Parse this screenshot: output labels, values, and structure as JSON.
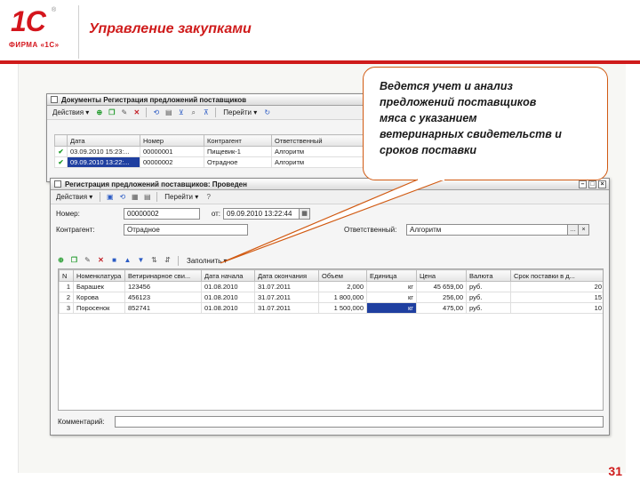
{
  "slide": {
    "logo_1c": "1С",
    "logo_reg": "®",
    "logo_firma": "ФИРМА «1С»",
    "title": "Управление закупками",
    "page_number": "31",
    "accent": "#cf1b1b"
  },
  "list_window": {
    "title": "Документы Регистрация предложений поставщиков",
    "toolbar": {
      "actions_label": "Действия ▾",
      "goto_label": "Перейти ▾"
    },
    "columns": [
      "Дата",
      "Номер",
      "Контрагент",
      "Ответственный"
    ],
    "rows": [
      {
        "date": "03.09.2010 15:23:...",
        "number": "00000001",
        "counterparty": "Пищевик-1",
        "responsible": "Алгоритм"
      },
      {
        "date": "09.09.2010 13:22:...",
        "number": "00000002",
        "counterparty": "Отрадное",
        "responsible": "Алгоритм"
      }
    ]
  },
  "doc_window": {
    "title": "Регистрация предложений поставщиков: Проведен",
    "toolbar": {
      "actions_label": "Действия ▾",
      "goto_label": "Перейти ▾"
    },
    "number_label": "Номер:",
    "number_value": "00000002",
    "from_label": "от:",
    "date_value": "09.09.2010 13:22:44",
    "counterparty_label": "Контрагент:",
    "counterparty_value": "Отрадное",
    "responsible_label": "Ответственный:",
    "responsible_value": "Алгоритм",
    "fill_label": "Заполнить ▾",
    "columns": [
      "N",
      "Номенклатура",
      "Ветиринарное сви...",
      "Дата начала",
      "Дата окончания",
      "Объем",
      "Единица",
      "Цена",
      "Валюта",
      "Срок поставки в д..."
    ],
    "rows": [
      {
        "n": "1",
        "item": "Барашек",
        "vet": "123456",
        "start": "01.08.2010",
        "end": "31.07.2011",
        "volume": "2,000",
        "unit": "кг",
        "price": "45 659,00",
        "currency": "руб.",
        "term": "20"
      },
      {
        "n": "2",
        "item": "Корова",
        "vet": "456123",
        "start": "01.08.2010",
        "end": "31.07.2011",
        "volume": "1 800,000",
        "unit": "кг",
        "price": "256,00",
        "currency": "руб.",
        "term": "15"
      },
      {
        "n": "3",
        "item": "Поросенок",
        "vet": "852741",
        "start": "01.08.2010",
        "end": "31.07.2011",
        "volume": "1 500,000",
        "unit": "кг",
        "price": "475,00",
        "currency": "руб.",
        "term": "10"
      }
    ],
    "comment_label": "Комментарий:"
  },
  "callout": {
    "lines": [
      "Ведется учет и анализ",
      "предложений поставщиков",
      "мяса с указанием",
      "ветеринарных свидетельств и",
      "сроков поставки"
    ],
    "border_color": "#d15a12"
  }
}
